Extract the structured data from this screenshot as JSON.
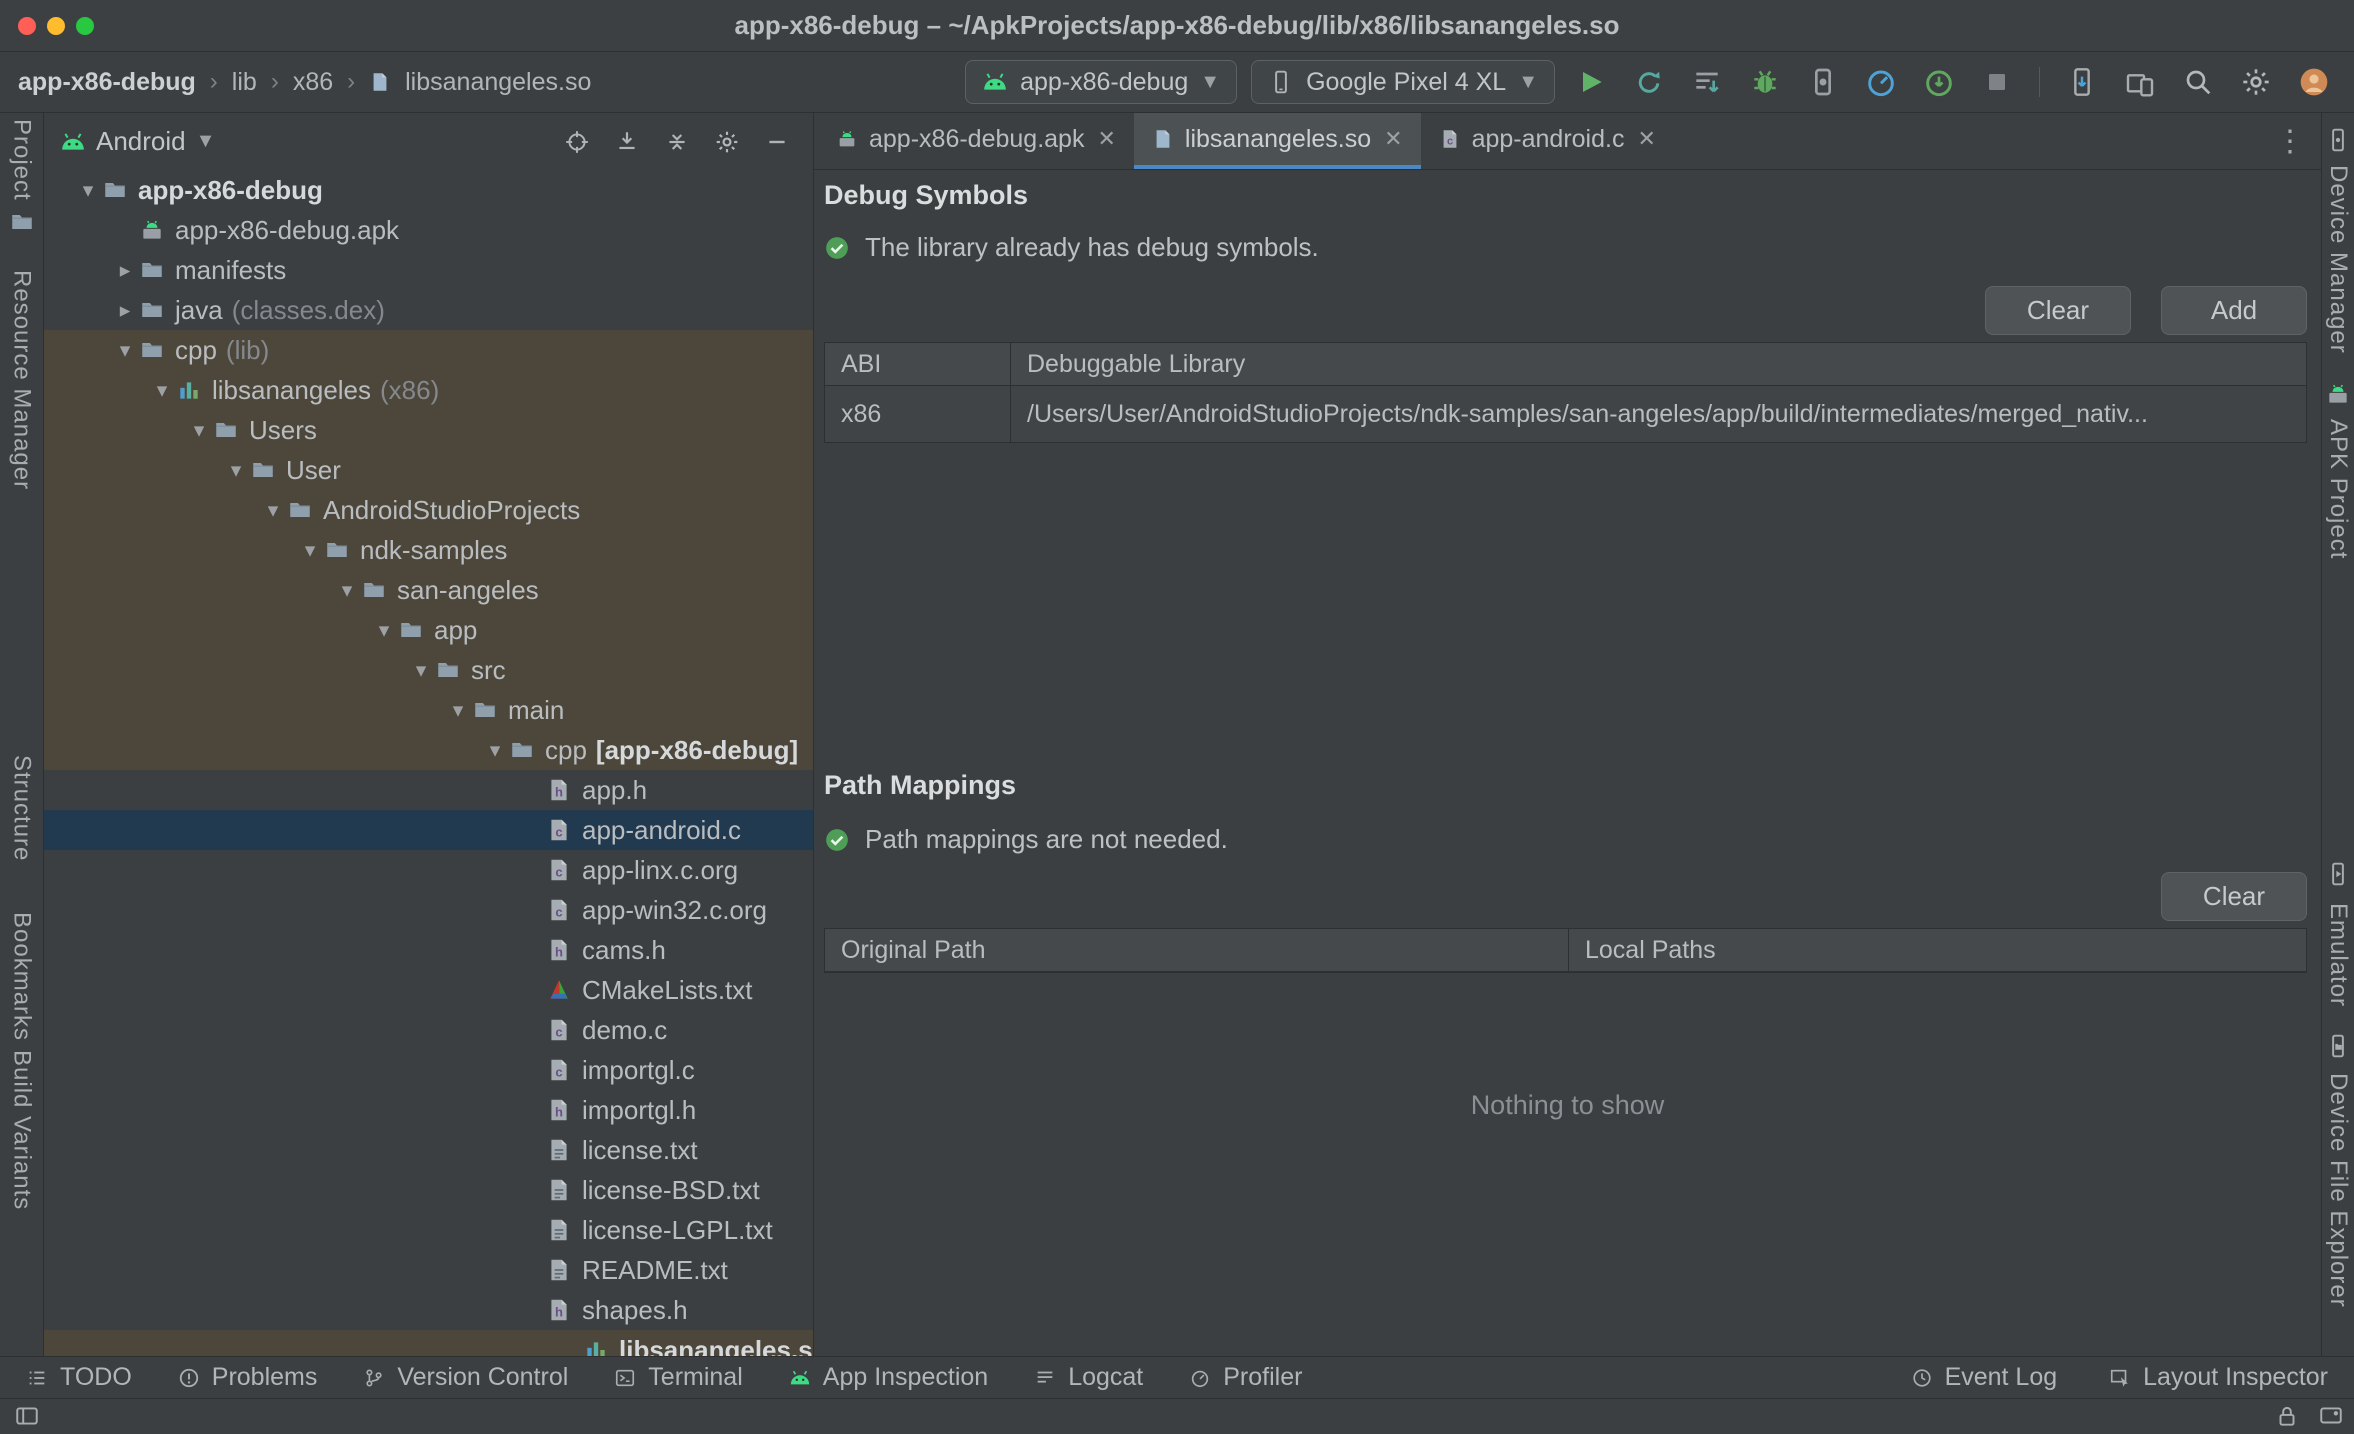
{
  "window": {
    "title": "app-x86-debug – ~/ApkProjects/app-x86-debug/lib/x86/libsanangeles.so"
  },
  "header": {
    "breadcrumbs": [
      "app-x86-debug",
      "lib",
      "x86",
      "libsanangeles.so"
    ],
    "run_config": {
      "label": "app-x86-debug"
    },
    "device": {
      "label": "Google Pixel 4 XL"
    }
  },
  "left_stripe": [
    {
      "label": "Project"
    },
    {
      "label": "Resource Manager"
    },
    {
      "label": "Structure"
    },
    {
      "label": "Bookmarks"
    },
    {
      "label": "Build Variants"
    }
  ],
  "right_stripe": [
    {
      "label": "Device Manager",
      "icon": "device-manager"
    },
    {
      "label": "APK Project",
      "icon": "apk"
    },
    {
      "label": "Emulator",
      "icon": "emulator"
    },
    {
      "label": "Device File Explorer",
      "icon": "device-file-explorer"
    }
  ],
  "project_panel": {
    "selector": "Android",
    "tree": [
      {
        "label": "app-x86-debug",
        "level": 0,
        "chevron": "down",
        "icon": "folder",
        "bold": true
      },
      {
        "label": "app-x86-debug.apk",
        "level": 1,
        "chevron": "none",
        "icon": "apk"
      },
      {
        "label": "manifests",
        "level": 1,
        "chevron": "right",
        "icon": "folder"
      },
      {
        "label": "java",
        "extra": "(classes.dex)",
        "level": 1,
        "chevron": "right",
        "icon": "folder"
      },
      {
        "label": "cpp",
        "extra": "(lib)",
        "level": 1,
        "chevron": "down",
        "icon": "folder",
        "row": "highlight"
      },
      {
        "label": "libsanangeles",
        "extra": "(x86)",
        "level": 2,
        "chevron": "down",
        "icon": "lib",
        "row": "highlight"
      },
      {
        "label": "Users",
        "level": 3,
        "chevron": "down",
        "icon": "folder",
        "row": "highlight"
      },
      {
        "label": "User",
        "level": 4,
        "chevron": "down",
        "icon": "folder",
        "row": "highlight"
      },
      {
        "label": "AndroidStudioProjects",
        "level": 5,
        "chevron": "down",
        "icon": "folder",
        "row": "highlight"
      },
      {
        "label": "ndk-samples",
        "level": 6,
        "chevron": "down",
        "icon": "folder",
        "row": "highlight"
      },
      {
        "label": "san-angeles",
        "level": 7,
        "chevron": "down",
        "icon": "folder",
        "row": "highlight"
      },
      {
        "label": "app",
        "level": 8,
        "chevron": "down",
        "icon": "folder",
        "row": "highlight"
      },
      {
        "label": "src",
        "level": 9,
        "chevron": "down",
        "icon": "folder",
        "row": "highlight"
      },
      {
        "label": "main",
        "level": 10,
        "chevron": "down",
        "icon": "folder",
        "row": "highlight"
      },
      {
        "label": "cpp",
        "suffix": "[app-x86-debug]",
        "level": 11,
        "chevron": "down",
        "icon": "folder",
        "row": "highlight"
      },
      {
        "label": "app.h",
        "level": 12,
        "chevron": "none",
        "icon": "h-file"
      },
      {
        "label": "app-android.c",
        "level": 12,
        "chevron": "none",
        "icon": "c-file",
        "row": "selected"
      },
      {
        "label": "app-linx.c.org",
        "level": 12,
        "chevron": "none",
        "icon": "c-file"
      },
      {
        "label": "app-win32.c.org",
        "level": 12,
        "chevron": "none",
        "icon": "c-file"
      },
      {
        "label": "cams.h",
        "level": 12,
        "chevron": "none",
        "icon": "h-file"
      },
      {
        "label": "CMakeLists.txt",
        "level": 12,
        "chevron": "none",
        "icon": "cmake"
      },
      {
        "label": "demo.c",
        "level": 12,
        "chevron": "none",
        "icon": "c-file"
      },
      {
        "label": "importgl.c",
        "level": 12,
        "chevron": "none",
        "icon": "c-file"
      },
      {
        "label": "importgl.h",
        "level": 12,
        "chevron": "none",
        "icon": "h-file"
      },
      {
        "label": "license.txt",
        "level": 12,
        "chevron": "none",
        "icon": "txt"
      },
      {
        "label": "license-BSD.txt",
        "level": 12,
        "chevron": "none",
        "icon": "txt"
      },
      {
        "label": "license-LGPL.txt",
        "level": 12,
        "chevron": "none",
        "icon": "txt"
      },
      {
        "label": "README.txt",
        "level": 12,
        "chevron": "none",
        "icon": "txt"
      },
      {
        "label": "shapes.h",
        "level": 12,
        "chevron": "none",
        "icon": "h-file"
      },
      {
        "label": "libsanangeles.so",
        "level": 13,
        "chevron": "none",
        "icon": "lib",
        "bold": true,
        "row": "highlight"
      }
    ]
  },
  "editor": {
    "tabs": [
      {
        "label": "app-x86-debug.apk",
        "icon": "apk",
        "active": false
      },
      {
        "label": "libsanangeles.so",
        "icon": "so-file",
        "active": true
      },
      {
        "label": "app-android.c",
        "icon": "c-file",
        "active": false
      }
    ],
    "debug_symbols": {
      "title": "Debug Symbols",
      "status": "The library already has debug symbols.",
      "clear_label": "Clear",
      "add_label": "Add",
      "table": {
        "headers": [
          "ABI",
          "Debuggable Library"
        ],
        "rows": [
          {
            "abi": "x86",
            "path": "/Users/User/AndroidStudioProjects/ndk-samples/san-angeles/app/build/intermediates/merged_nativ..."
          }
        ]
      }
    },
    "path_mappings": {
      "title": "Path Mappings",
      "status": "Path mappings are not needed.",
      "clear_label": "Clear",
      "table": {
        "headers": [
          "Original Path",
          "Local Paths"
        ]
      },
      "empty": "Nothing to show"
    }
  },
  "bottom_bar": {
    "left": [
      {
        "label": "TODO",
        "icon": "todo"
      },
      {
        "label": "Problems",
        "icon": "problems"
      },
      {
        "label": "Version Control",
        "icon": "branch"
      },
      {
        "label": "Terminal",
        "icon": "terminal"
      },
      {
        "label": "App Inspection",
        "icon": "android-head"
      },
      {
        "label": "Logcat",
        "icon": "logcat"
      },
      {
        "label": "Profiler",
        "icon": "profiler"
      }
    ],
    "right": [
      {
        "label": "Event Log",
        "icon": "event-log"
      },
      {
        "label": "Layout Inspector",
        "icon": "layout-inspector"
      }
    ]
  },
  "colors": {
    "accent_blue": "#4a88c7",
    "android_green": "#3ddc84",
    "success_green": "#4f9e58",
    "highlight_row": "#4d473b",
    "selected_row": "#223a50"
  }
}
